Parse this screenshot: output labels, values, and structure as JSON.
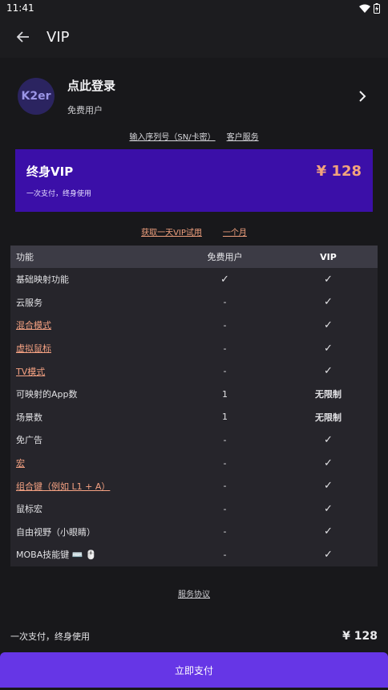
{
  "status": {
    "time": "11:41"
  },
  "header": {
    "title": "VIP"
  },
  "profile": {
    "avatar_text": "K2er",
    "login": "点此登录",
    "user_type": "免费用户"
  },
  "links": {
    "serial": "输入序列号（SN/卡密）",
    "support": "客户服务"
  },
  "plan": {
    "name": "终身VIP",
    "price": "¥ 128",
    "subtitle": "一次支付，终身使用"
  },
  "trial": {
    "one_day": "获取一天VIP试用",
    "one_month": "一个月"
  },
  "table": {
    "headers": [
      "功能",
      "免费用户",
      "VIP"
    ],
    "rows": [
      {
        "feature": "基础映射功能",
        "free": "✓",
        "vip": "✓"
      },
      {
        "feature": "云服务",
        "free": "-",
        "vip": "✓"
      },
      {
        "feature": "混合模式",
        "free": "-",
        "vip": "✓"
      },
      {
        "feature": "虚拟鼠标",
        "free": "-",
        "vip": "✓"
      },
      {
        "feature": "TV模式",
        "free": "-",
        "vip": "✓"
      },
      {
        "feature": "可映射的App数",
        "free": "1",
        "vip": "无限制"
      },
      {
        "feature": "场景数",
        "free": "1",
        "vip": "无限制"
      },
      {
        "feature": "免广告",
        "free": "-",
        "vip": "✓"
      },
      {
        "feature": "宏",
        "free": "-",
        "vip": "✓"
      },
      {
        "feature": "组合键（例如 L1 + A）",
        "free": "-",
        "vip": "✓"
      },
      {
        "feature": "鼠标宏",
        "free": "-",
        "vip": "✓"
      },
      {
        "feature": "自由视野（小眼睛）",
        "free": "-",
        "vip": "✓"
      },
      {
        "feature": "MOBA技能键 ⌨️ 🖱️",
        "free": "-",
        "vip": "✓"
      }
    ]
  },
  "terms": "服务协议",
  "bottom": {
    "desc": "一次支付，终身使用",
    "price": "¥ 128"
  },
  "pay_button": "立即支付",
  "colors": {
    "accent": "#6636e6",
    "card": "#3b0fa8",
    "price": "#f2a37c",
    "link": "#f4a182"
  }
}
